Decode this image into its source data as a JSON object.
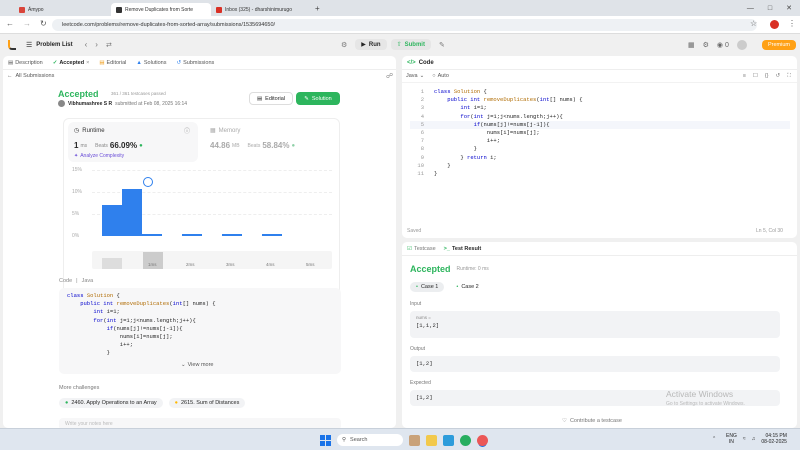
{
  "browser": {
    "tabs": [
      {
        "label": "Ámypo",
        "color": "#d9443a"
      },
      {
        "label": "Remove Duplicates from Sorte",
        "color": "#333333"
      },
      {
        "label": "Inbox (325) - dharshinimurugo",
        "color": "#d93025"
      }
    ],
    "new_tab": "+",
    "url": "leetcode.com/problems/remove-duplicates-from-sorted-array/submissions/1535694650/"
  },
  "lc_header": {
    "problem_list": "Problem List",
    "run": "Run",
    "submit": "Submit",
    "streak": "0",
    "premium": "Premium"
  },
  "left": {
    "tabs": [
      "Description",
      "Accepted",
      "Editorial",
      "Solutions",
      "Submissions"
    ],
    "all_submissions": "All Submissions",
    "status": "Accepted",
    "testcases": "361 / 361 testcases passed",
    "author": "Vibhumashree S R",
    "submitted": "submitted at Feb 08, 2025 16:14",
    "editorial_btn": "Editorial",
    "solution_btn": "Solution",
    "runtime_label": "Runtime",
    "runtime_value": "1",
    "runtime_unit": "ms",
    "beats_label": "Beats",
    "runtime_beats": "66.09%",
    "analyze": "Analyze Complexity",
    "memory_label": "Memory",
    "memory_value": "44.86",
    "memory_unit": "MB",
    "memory_beats": "58.84%",
    "y_ticks": [
      "15%",
      "10%",
      "5%",
      "0%"
    ],
    "x_ticks": [
      "1ms",
      "2ms",
      "3ms",
      "4ms",
      "5ms"
    ],
    "code_header": "Code",
    "code_lang": "Java",
    "code_lines": [
      "class Solution {",
      "    public int removeDuplicates(int[] nums) {",
      "        int i=1;",
      "        for(int j=1;j<nums.length;j++){",
      "            if(nums[j]!=nums[j-1]){",
      "                nums[i]=nums[j];",
      "                i++;",
      "            }"
    ],
    "view_more": "View more",
    "more_challenges": "More challenges",
    "challenges": [
      "2460. Apply Operations to an Array",
      "2615. Sum of Distances"
    ],
    "notes_placeholder": "Write your notes here"
  },
  "chart_data": {
    "type": "bar",
    "categories": [
      "1ms",
      "",
      "2ms",
      "",
      "3ms",
      "",
      "4ms",
      "",
      "5ms"
    ],
    "values": [
      8,
      12,
      0.2,
      0,
      0.2,
      0,
      0.2,
      0,
      0.2
    ],
    "ylim": [
      0,
      17
    ],
    "y_ticks": [
      "15%",
      "10%",
      "5%",
      "0%"
    ],
    "highlight_index": 1
  },
  "editor": {
    "title": "Code",
    "lang": "Java",
    "mode": "Auto",
    "lines": [
      "class Solution {",
      "    public int removeDuplicates(int[] nums) {",
      "        int i=1;",
      "        for(int j=1;j<nums.length;j++){",
      "            if(nums[j]!=nums[j-1]){",
      "                nums[i]=nums[j];",
      "                i++;",
      "            }",
      "        } return i;",
      "    }",
      "}"
    ],
    "line_numbers": [
      "1",
      "2",
      "3",
      "4",
      "5",
      "6",
      "7",
      "8",
      "9",
      "10",
      "11"
    ],
    "saved": "Saved",
    "cursor": "Ln 5, Col 30"
  },
  "testpanel": {
    "tab_testcase": "Testcase",
    "tab_result": "Test Result",
    "status": "Accepted",
    "runtime": "Runtime: 0 ms",
    "cases": [
      "Case 1",
      "Case 2"
    ],
    "input_label": "Input",
    "param": "nums =",
    "input_value": "[1,1,2]",
    "output_label": "Output",
    "output_value": "[1,2]",
    "expected_label": "Expected",
    "expected_value": "[1,2]",
    "contribute": "Contribute a testcase",
    "activate_title": "Activate Windows",
    "activate_sub": "Go to Settings to activate Windows."
  },
  "taskbar": {
    "search": "Search",
    "lang1": "ENG",
    "lang2": "IN",
    "time": "04:15 PM",
    "date": "08-02-2025"
  }
}
